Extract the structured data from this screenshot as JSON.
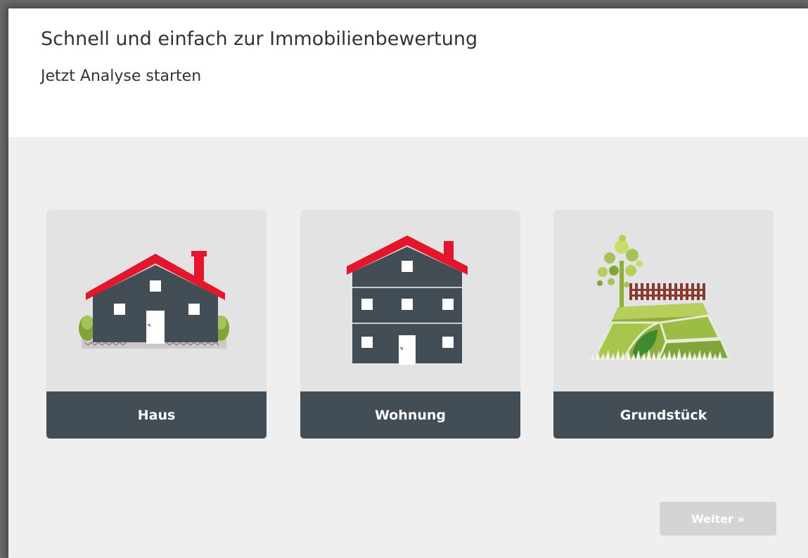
{
  "header": {
    "title": "Schnell und einfach zur Immobilienbewertung",
    "subtitle": "Jetzt Analyse starten"
  },
  "options": [
    {
      "label": "Haus",
      "icon": "house-icon"
    },
    {
      "label": "Wohnung",
      "icon": "apartment-building-icon"
    },
    {
      "label": "Grundstück",
      "icon": "land-plot-icon"
    }
  ],
  "footer": {
    "next_label": "Weiter »",
    "next_disabled": true
  },
  "colors": {
    "roof": "#e3162b",
    "building": "#434d55",
    "card": "#e3e3e3",
    "label_bar": "#434d55",
    "button_disabled": "#d4d4d4",
    "green_light": "#a4c639",
    "green_dark": "#4c9a2a",
    "fence": "#8b3a2f"
  }
}
